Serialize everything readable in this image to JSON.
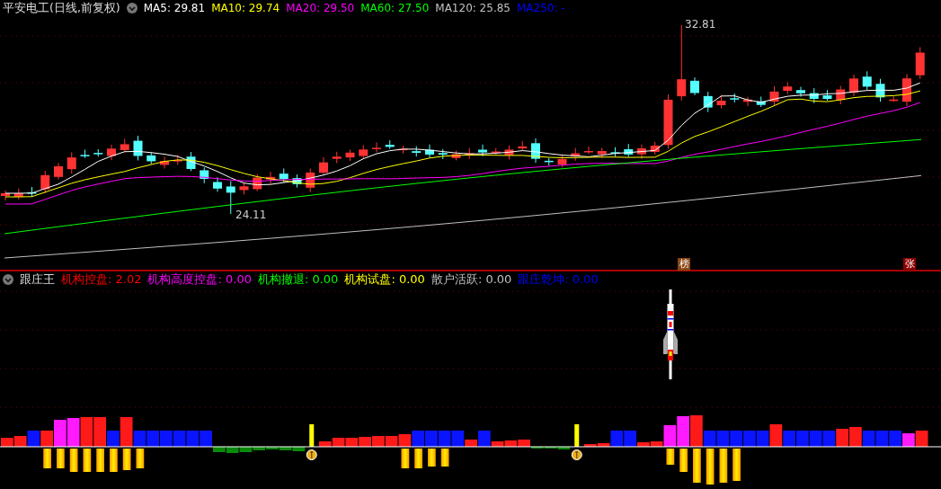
{
  "price_panel": {
    "title": "平安电工(日线,前复权)",
    "legend": [
      {
        "label": "MA5: 29.81",
        "color": "#ffffff"
      },
      {
        "label": "MA10: 29.74",
        "color": "#ffff00"
      },
      {
        "label": "MA20: 29.50",
        "color": "#ff00ff"
      },
      {
        "label": "MA60: 27.50",
        "color": "#00ff00"
      },
      {
        "label": "MA120: 25.85",
        "color": "#c0c0c0"
      },
      {
        "label": "MA250: -",
        "color": "#0000ff"
      }
    ],
    "high_label": "32.81",
    "low_label": "24.11",
    "badges": [
      {
        "label": "榜",
        "color": "#8b4513"
      },
      {
        "label": "张",
        "color": "#8b0000"
      }
    ]
  },
  "indicator_panel": {
    "title": "跟庄王",
    "legend": [
      {
        "label": "机构控盘: 2.02",
        "color": "#ff0000"
      },
      {
        "label": "机构高度控盘: 0.00",
        "color": "#ff00ff"
      },
      {
        "label": "机构撤退: 0.00",
        "color": "#00ff00"
      },
      {
        "label": "机构试盘: 0.00",
        "color": "#ffff00"
      },
      {
        "label": "散户活跃: 0.00",
        "color": "#c0c0c0"
      },
      {
        "label": "跟庄乾坤: 0.00",
        "color": "#0000ff"
      }
    ]
  }
}
